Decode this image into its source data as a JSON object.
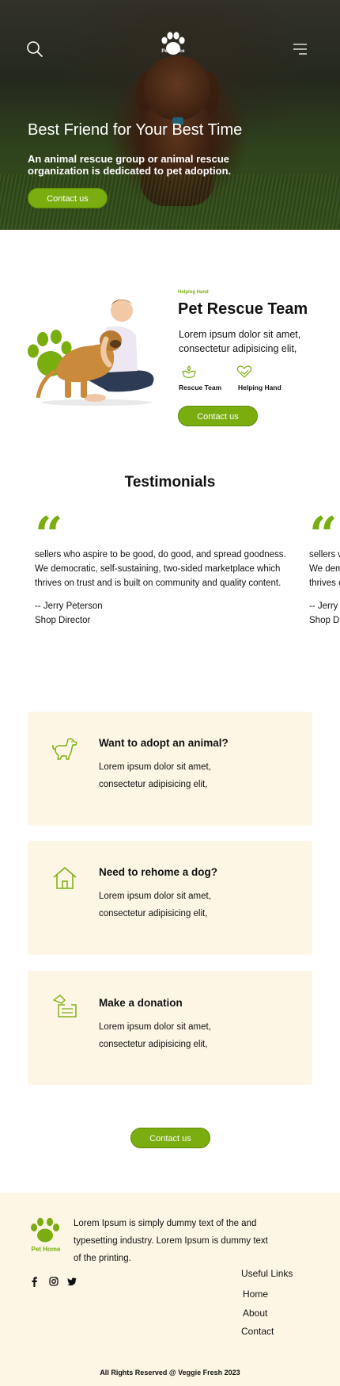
{
  "hero": {
    "logo_text": "Pet Home",
    "title": "Best Friend for Your Best Time",
    "subtitle": "An animal rescue group or animal rescue organization is dedicated to pet adoption.",
    "button": "Contact us"
  },
  "about": {
    "eyebrow": "Helping Hand",
    "title": "Pet Rescue Team",
    "text": "Lorem ipsum dolor sit amet, consectetur adipisicing elit,",
    "features": [
      "Rescue Team",
      "Helping Hand"
    ],
    "button": "Contact us"
  },
  "testimonials": {
    "title": "Testimonials",
    "items": [
      {
        "line1": "sellers who aspire to be good, do good, and spread goodness.",
        "line2": "We democratic, self-sustaining, two-sided marketplace which",
        "line3": "thrives on trust and is built on community and quality content.",
        "author": "-- Jerry Peterson",
        "role": "Shop Director"
      },
      {
        "line1": "sellers w",
        "line2": "We dem",
        "line3": "thrives o",
        "author": "-- Jerry",
        "role": "Shop D"
      }
    ]
  },
  "cards": [
    {
      "icon": "dog-icon",
      "title": "Want to adopt an animal?",
      "line1": "Lorem ipsum dolor sit amet,",
      "line2": "consectetur adipisicing elit,"
    },
    {
      "icon": "house-icon",
      "title": "Need to rehome a dog?",
      "line1": "Lorem ipsum dolor sit amet,",
      "line2": "consectetur adipisicing elit,"
    },
    {
      "icon": "donation-icon",
      "title": "Make a donation",
      "line1": "Lorem ipsum dolor sit amet,",
      "line2": "consectetur adipisicing elit,"
    }
  ],
  "cards_button": "Contact us",
  "footer": {
    "logo_text": "Pet Home",
    "text": "Lorem Ipsum is simply dummy text of the and typesetting industry. Lorem Ipsum is dummy text of the printing.",
    "links_title": "Useful Links",
    "links": [
      "Home",
      "About",
      "Contact"
    ],
    "copyright": "All Rights Reserved @ Veggie Fresh 2023"
  },
  "colors": {
    "accent": "#7aad0f",
    "card_bg": "#fdf6e5"
  }
}
